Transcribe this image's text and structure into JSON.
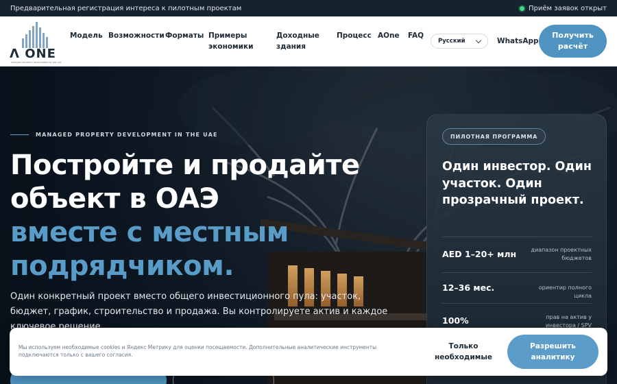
{
  "topbar": {
    "announcement": "Предварительная регистрация интереса к пилотным проектам",
    "status": "Приём заявок открыт",
    "status_color": "#3ddc84"
  },
  "header": {
    "logo_text": "Λ ONE",
    "logo_tagline": "MANAGED PROPERTY DEVELOPMENT IN THE UAE",
    "nav": [
      {
        "label": "Модель"
      },
      {
        "label": "Возможности"
      },
      {
        "label": "Форматы"
      },
      {
        "label": "Примеры экономики"
      },
      {
        "label": "Доходные здания"
      },
      {
        "label": "Процесс"
      },
      {
        "label": "AOne"
      },
      {
        "label": "FAQ"
      }
    ],
    "language": "Русский",
    "whatsapp": "WhatsApp",
    "cta": "Получить расчёт",
    "accent_color": "#4f93c0"
  },
  "hero": {
    "eyebrow": "MANAGED PROPERTY DEVELOPMENT IN THE UAE",
    "title_white": [
      "Постройте и продайте",
      "объект в ОАЭ"
    ],
    "title_blue": [
      "вместе с местным",
      "подрядчиком."
    ],
    "lead": "Один конкретный проект вместо общего инвестиционного пула: участок, бюджет, график, строительство и продажа. Вы контролируете актив и каждое ключевое решение."
  },
  "card": {
    "pill": "ПИЛОТНАЯ ПРОГРАММА",
    "title": "Один инвестор. Один участок. Один прозрачный проект.",
    "stats": [
      {
        "value": "AED 1–20+ млн",
        "desc": "диапазон проектных бюджетов"
      },
      {
        "value": "12–36 мес.",
        "desc": "ориентир полного цикла"
      },
      {
        "value": "100%",
        "desc": "прав на актив у инвестора / SPV"
      }
    ]
  },
  "cookie": {
    "text": "Мы используем необходимые cookies и Яндекс Метрику для оценки посещаемости. Дополнительные аналитические инструменты подключаются только с вашего согласия.",
    "necessary": "Только необходимые",
    "allow": "Разрешить аналитику"
  }
}
